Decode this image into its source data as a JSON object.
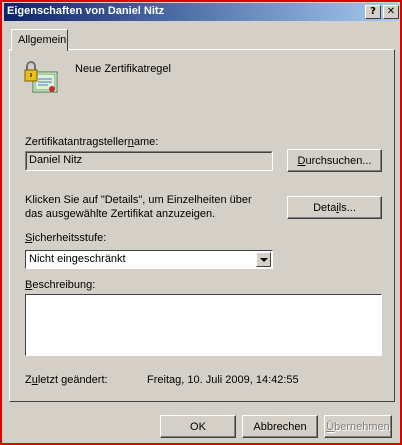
{
  "window": {
    "title": "Eigenschaften von Daniel Nitz",
    "help_glyph": "?",
    "close_glyph": "✕"
  },
  "tabs": [
    {
      "label": "Allgemein",
      "active": true
    }
  ],
  "general": {
    "icon": "certificate-icon",
    "heading": "Neue Zertifikatregel",
    "requester_label_pre": "Zertifikatantragsteller",
    "requester_label_mn": "n",
    "requester_label_post": "ame:",
    "requester_value": "Daniel Nitz",
    "browse_pre": "",
    "browse_mn": "D",
    "browse_post": "urchsuchen...",
    "details_text_line1": "Klicken Sie auf \"Details\", um Einzelheiten über",
    "details_text_line2": "das ausgewählte Zertifikat anzuzeigen.",
    "details_pre": "Deta",
    "details_mn": "i",
    "details_post": "ls...",
    "security_label_pre": "",
    "security_label_mn": "S",
    "security_label_post": "icherheitsstufe:",
    "security_value": "Nicht eingeschränkt",
    "description_label_pre": "",
    "description_label_mn": "B",
    "description_label_post": "eschreibung:",
    "description_value": "",
    "modified_label_pre": "Z",
    "modified_label_mn": "u",
    "modified_label_post": "letzt geändert:",
    "modified_value": "Freitag, 10. Juli 2009, 14:42:55"
  },
  "footer": {
    "ok_label": "OK",
    "cancel_label": "Abbrechen",
    "apply_pre": "",
    "apply_mn": "Ü",
    "apply_post": "bernehmen"
  },
  "colors": {
    "titlebar_start": "#0a246a",
    "titlebar_end": "#a6caf0",
    "dialog_face": "#d4d0c8",
    "window_border": "#e00000"
  }
}
